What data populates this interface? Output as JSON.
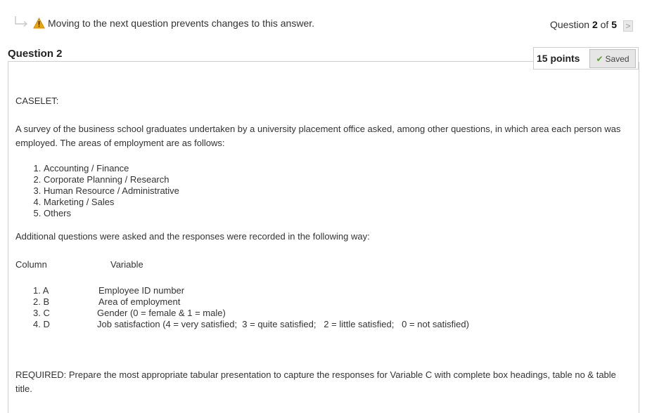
{
  "warning": {
    "text": "Moving to the next question prevents changes to this answer."
  },
  "navigation": {
    "prefix": "Question ",
    "current": "2",
    "of": " of ",
    "total": "5",
    "next_symbol": ">"
  },
  "question": {
    "heading": "Question 2",
    "points": "15 points",
    "saved_label": "Saved"
  },
  "content": {
    "caselet": "CASELET:",
    "intro": "A survey of the business school graduates undertaken by a university placement office asked, among other questions, in which area each person was employed.  The areas of employment are as follows:",
    "areas": [
      "Accounting / Finance",
      "Corporate Planning / Research",
      "Human Resource / Administrative",
      "Marketing / Sales",
      "Others"
    ],
    "additional": "Additional questions were asked and the responses were recorded in the following way:",
    "column_header": "Column",
    "variable_header": "Variable",
    "rows": [
      {
        "column": "1. A",
        "variable": "Employee ID number"
      },
      {
        "column": "2. B",
        "variable": "Area of employment"
      },
      {
        "column": "3. C",
        "variable": "Gender (0 = female  &  1 = male)"
      },
      {
        "column": "4. D",
        "variable": "Job satisfaction (4 = very satisfied;  3 = quite satisfied;   2 = little satisfied;   0 = not satisfied)"
      }
    ],
    "required": "REQUIRED: Prepare the most appropriate tabular presentation to capture the responses for Variable C with complete box headings, table no & table title."
  }
}
